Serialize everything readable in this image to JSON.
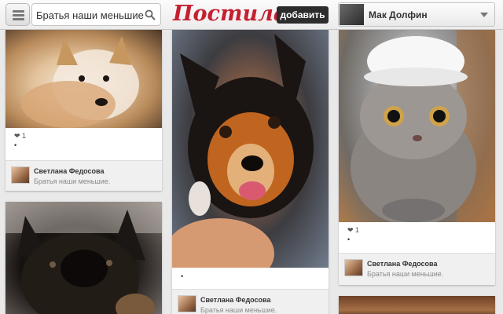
{
  "header": {
    "search_value": "Братья наши меньшие",
    "logo": "Постила",
    "add_button": "добавить",
    "user_name": "Мак Долфин"
  },
  "pins": [
    {
      "likes": "❤ 1",
      "dot": "•",
      "author": "Светлана Федосова",
      "board": "Братья наши меньшие."
    },
    {
      "dot": "•",
      "author": "Светлана Федосова",
      "board": "Братья наши меньшие."
    },
    {
      "likes": "❤ 1",
      "dot": "•",
      "author": "Светлана Федосова",
      "board": "Братья наши меньшие."
    }
  ]
}
